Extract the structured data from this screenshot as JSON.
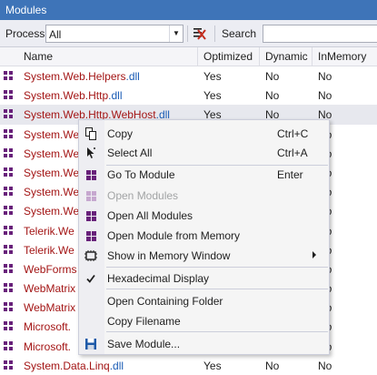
{
  "window": {
    "title": "Modules"
  },
  "toolbar": {
    "process_label": "Process",
    "process_value": "All",
    "search_label": "Search",
    "search_value": ""
  },
  "columns": {
    "name": "Name",
    "optimized": "Optimized",
    "dynamic": "Dynamic",
    "inmemory": "InMemory"
  },
  "rows": [
    {
      "name": "System.Web.Helpers",
      "ext": ".dll",
      "optimized": "Yes",
      "dynamic": "No",
      "inmemory": "No"
    },
    {
      "name": "System.Web.Http",
      "ext": ".dll",
      "optimized": "Yes",
      "dynamic": "No",
      "inmemory": "No"
    },
    {
      "name": "System.Web.Http.WebHost",
      "ext": ".dll",
      "optimized": "Yes",
      "dynamic": "No",
      "inmemory": "No"
    },
    {
      "name": "System.We",
      "ext": "",
      "optimized": "",
      "dynamic": "",
      "inmemory": "No"
    },
    {
      "name": "System.We",
      "ext": "",
      "optimized": "",
      "dynamic": "",
      "inmemory": "No"
    },
    {
      "name": "System.We",
      "ext": "",
      "optimized": "",
      "dynamic": "",
      "inmemory": "No"
    },
    {
      "name": "System.We",
      "ext": "",
      "optimized": "",
      "dynamic": "",
      "inmemory": "No"
    },
    {
      "name": "System.We",
      "ext": "",
      "optimized": "",
      "dynamic": "",
      "inmemory": "No"
    },
    {
      "name": "Telerik.We",
      "ext": "",
      "optimized": "",
      "dynamic": "",
      "inmemory": "No"
    },
    {
      "name": "Telerik.We",
      "ext": "",
      "optimized": "",
      "dynamic": "",
      "inmemory": "No"
    },
    {
      "name": "WebForms",
      "ext": "",
      "optimized": "",
      "dynamic": "",
      "inmemory": "No"
    },
    {
      "name": "WebMatrix",
      "ext": "",
      "optimized": "",
      "dynamic": "",
      "inmemory": "No"
    },
    {
      "name": "WebMatrix",
      "ext": "",
      "optimized": "",
      "dynamic": "",
      "inmemory": "No"
    },
    {
      "name": "Microsoft.",
      "ext": "",
      "optimized": "",
      "dynamic": "",
      "inmemory": "No"
    },
    {
      "name": "Microsoft.",
      "ext": "",
      "optimized": "",
      "dynamic": "",
      "inmemory": "No"
    },
    {
      "name": "System.Data.Linq",
      "ext": ".dll",
      "optimized": "Yes",
      "dynamic": "No",
      "inmemory": "No"
    }
  ],
  "context_menu": {
    "copy": {
      "label": "Copy",
      "shortcut": "Ctrl+C"
    },
    "select_all": {
      "label": "Select All",
      "shortcut": "Ctrl+A"
    },
    "go_to_module": {
      "label": "Go To Module",
      "shortcut": "Enter"
    },
    "open_modules": {
      "label": "Open Modules"
    },
    "open_all_modules": {
      "label": "Open All Modules"
    },
    "open_module_from_memory": {
      "label": "Open Module from Memory"
    },
    "show_in_memory_window": {
      "label": "Show in Memory Window"
    },
    "hexadecimal_display": {
      "label": "Hexadecimal Display",
      "checked": true
    },
    "open_containing_folder": {
      "label": "Open Containing Folder"
    },
    "copy_filename": {
      "label": "Copy Filename"
    },
    "save_module": {
      "label": "Save Module..."
    }
  },
  "colors": {
    "title_bar": "#3e74b8",
    "module_name": "#a31515",
    "file_extension": "#1a5cb5",
    "module_icon": "#68217a"
  }
}
